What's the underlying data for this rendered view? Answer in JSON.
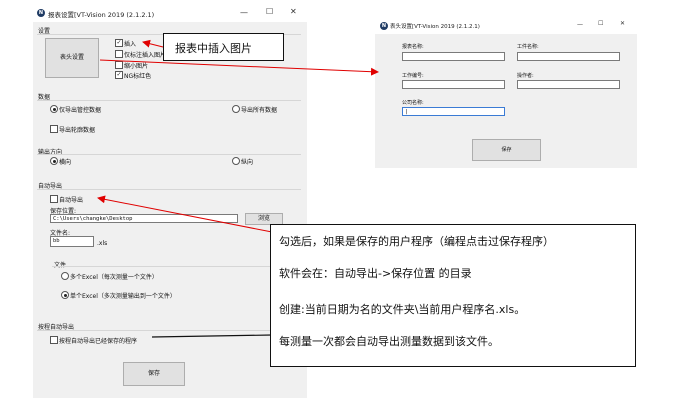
{
  "main_window": {
    "title": "报表设置[VT-Vision 2019  (2.1.2.1)",
    "settings_group": "设置",
    "header_button": "表头设置",
    "checkboxes": [
      {
        "label": "插入",
        "checked": true
      },
      {
        "label": "仅标注插入图片",
        "checked": false
      },
      {
        "label": "缩小图片",
        "checked": false
      },
      {
        "label": "NG标红色",
        "checked": true
      }
    ],
    "data_group": "数据",
    "data_options": {
      "export_controlled": "仅导出管控数据",
      "export_all": "导出所有数据",
      "selected": "export_controlled"
    },
    "export_outline": "导出轮廓数据",
    "output_direction_group": "输出方向",
    "direction_options": {
      "horizontal": "横向",
      "vertical": "纵向",
      "selected": "horizontal"
    },
    "auto_export_group": "自动导出",
    "auto_export_label": "自动导出",
    "save_location_label": "保存位置:",
    "save_location_value": "C:\\Users\\changke\\Desktop",
    "browse_button": "浏览",
    "file_name_label": "文件名:",
    "file_name_value": "bb",
    "file_ext": ".xls",
    "file_group": "文件",
    "file_options": {
      "multi": "多个Excel（每次测量一个文件）",
      "single": "单个Excel（多次测量输出到一个文件）",
      "selected": "single"
    },
    "prog_auto_export_group": "按程自动导出",
    "prog_auto_export_label": "按程自动导出已经保存的程序",
    "save_button": "保存"
  },
  "header_window": {
    "title": "表头设置[VT-Vision 2019  (2.1.2.1)",
    "fields": {
      "report_name": "报表名称:",
      "workpiece_name": "工件名称:",
      "work_number": "工作编号:",
      "operator": "操作者:",
      "company_name": "公司名称:"
    },
    "save_button": "保存"
  },
  "annotations": {
    "callout_top": "报表中插入图片",
    "callout_lines": [
      "勾选后，如果是保存的用户程序（编程点击过保存程序）",
      "软件会在：自动导出->保存位置 的目录",
      "创建:当前日期为名的文件夹\\当前用户程序名.xls。",
      "每测量一次都会自动导出测量数据到该文件。"
    ],
    "arrow_color": "#e00000"
  },
  "window_controls": {
    "minimize": "—",
    "maximize": "☐",
    "close": "✕"
  }
}
